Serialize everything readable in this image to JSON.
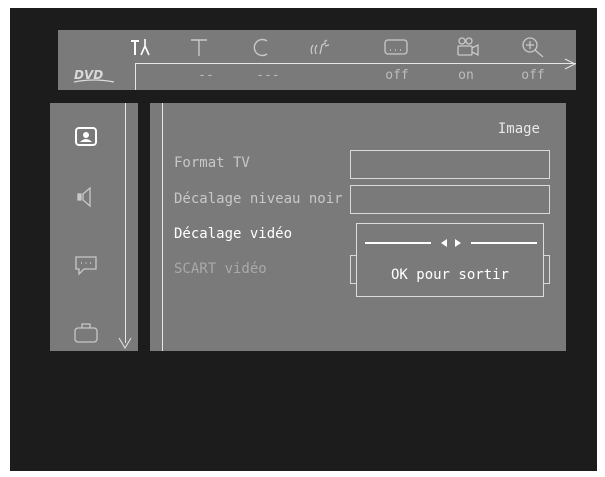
{
  "topbar": {
    "icons": [
      {
        "name": "settings-icon",
        "active": true
      },
      {
        "name": "title-icon",
        "active": false
      },
      {
        "name": "chapter-icon",
        "active": false
      },
      {
        "name": "audio-icon",
        "active": false
      },
      {
        "name": "subtitle-icon",
        "active": false
      },
      {
        "name": "camera-angle-icon",
        "active": false
      },
      {
        "name": "zoom-icon",
        "active": false
      }
    ],
    "logo": "DVD",
    "status": [
      "--",
      "---",
      "off",
      "on",
      "off"
    ]
  },
  "sidebar": {
    "icons": [
      "picture-icon",
      "sound-icon",
      "language-icon",
      "features-icon"
    ]
  },
  "panel": {
    "title": "Image",
    "items": [
      {
        "label": "Format TV"
      },
      {
        "label": "Décalage niveau noir"
      },
      {
        "label": "Décalage vidéo"
      },
      {
        "label": "SCART vidéo"
      }
    ],
    "popup": {
      "slider_icon": "left-right-arrows-icon",
      "text": "OK pour sortir"
    }
  }
}
